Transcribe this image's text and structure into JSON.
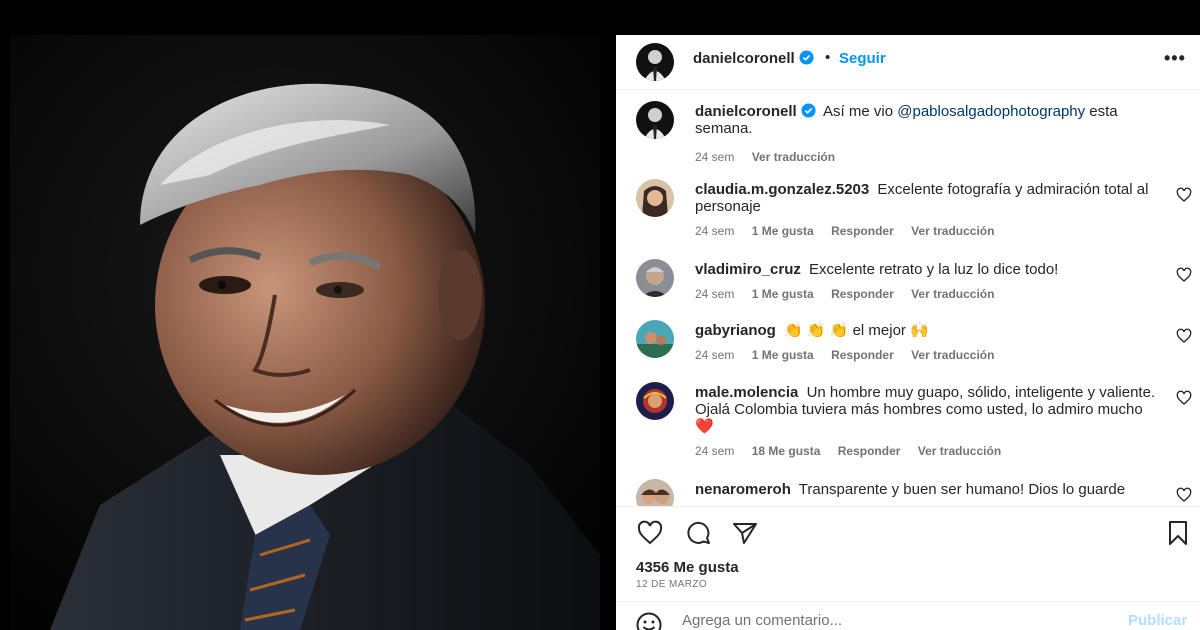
{
  "post": {
    "username": "danielcoronell",
    "follow_label": "Seguir",
    "dot": "•",
    "more_label": "•••",
    "caption": "Así me vio",
    "mention": "@pablosalgadophotography",
    "caption_end": "esta semana.",
    "caption_age": "24 sem",
    "translate_label": "Ver traducción"
  },
  "comments": [
    {
      "user": "claudia.m.gonzalez.5203",
      "text": "Excelente fotografía y admiración total al personaje",
      "age": "24 sem",
      "likes": "1 Me gusta",
      "reply": "Responder",
      "translate": "Ver traducción"
    },
    {
      "user": "vladimiro_cruz",
      "text": "Excelente retrato y la luz lo dice todo!",
      "age": "24 sem",
      "likes": "1 Me gusta",
      "reply": "Responder",
      "translate": "Ver traducción"
    },
    {
      "user": "gabyrianog",
      "text": "👏 👏 👏  el mejor 🙌",
      "age": "24 sem",
      "likes": "1 Me gusta",
      "reply": "Responder",
      "translate": "Ver traducción"
    },
    {
      "user": "male.molencia",
      "text": "Un hombre muy guapo, sólido, inteligente y valiente. Ojalá Colombia tuviera más hombres como usted, lo admiro mucho❤️",
      "age": "24 sem",
      "likes": "18 Me gusta",
      "reply": "Responder",
      "translate": "Ver traducción"
    },
    {
      "user": "nenaromeroh",
      "text": "Transparente y buen ser humano! Dios lo guarde"
    }
  ],
  "footer": {
    "likes": "4356 Me gusta",
    "date": "12 DE MARZO",
    "comment_placeholder": "Agrega un comentario...",
    "publish_label": "Publicar"
  },
  "icons": {
    "like": "heart-icon",
    "comment": "comment-icon",
    "share": "share-icon",
    "save": "bookmark-icon",
    "verified": "verified-badge-icon",
    "emoji": "emoji-icon"
  },
  "colors": {
    "link_blue": "#0095f6",
    "verified_blue": "#0095f6",
    "mention": "#00376b",
    "muted": "#737373"
  }
}
